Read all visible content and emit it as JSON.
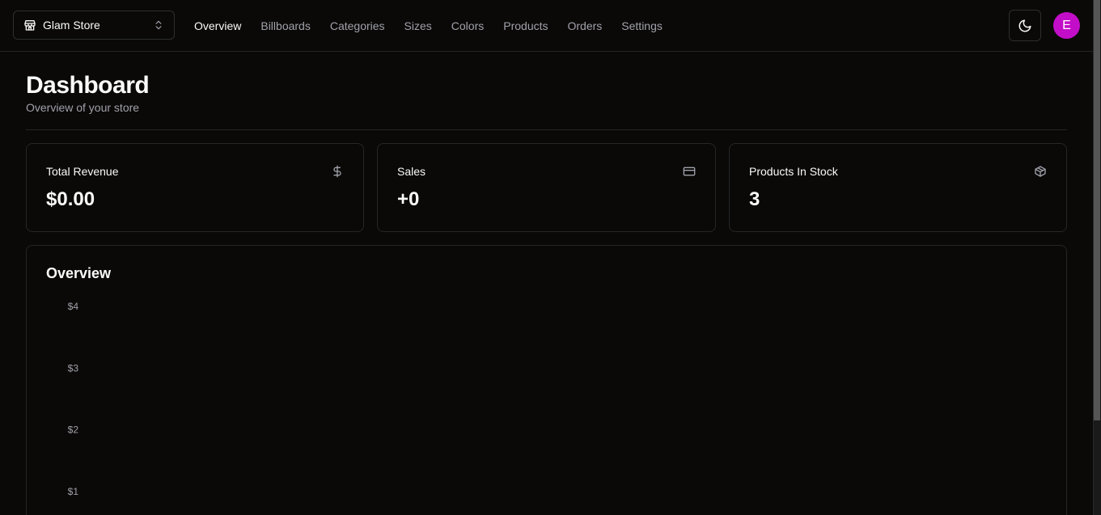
{
  "header": {
    "store_name": "Glam Store",
    "nav": [
      {
        "label": "Overview",
        "active": true
      },
      {
        "label": "Billboards",
        "active": false
      },
      {
        "label": "Categories",
        "active": false
      },
      {
        "label": "Sizes",
        "active": false
      },
      {
        "label": "Colors",
        "active": false
      },
      {
        "label": "Products",
        "active": false
      },
      {
        "label": "Orders",
        "active": false
      },
      {
        "label": "Settings",
        "active": false
      }
    ],
    "theme_icon": "moon-icon",
    "avatar_initial": "E",
    "avatar_color": "#c30ec9"
  },
  "page": {
    "title": "Dashboard",
    "subtitle": "Overview of your store"
  },
  "cards": [
    {
      "title": "Total Revenue",
      "value": "$0.00",
      "icon": "dollar-icon"
    },
    {
      "title": "Sales",
      "value": "+0",
      "icon": "credit-card-icon"
    },
    {
      "title": "Products In Stock",
      "value": "3",
      "icon": "package-icon"
    }
  ],
  "overview": {
    "title": "Overview"
  },
  "chart_data": {
    "type": "bar",
    "title": "Overview",
    "y_tick_labels": [
      "$4",
      "$3",
      "$2",
      "$1"
    ],
    "ylim": [
      0,
      4
    ],
    "series": [],
    "grid": false
  },
  "colors": {
    "background": "#0a0908",
    "accent_avatar": "#c30ec9",
    "muted_text": "#a1a1aa"
  }
}
